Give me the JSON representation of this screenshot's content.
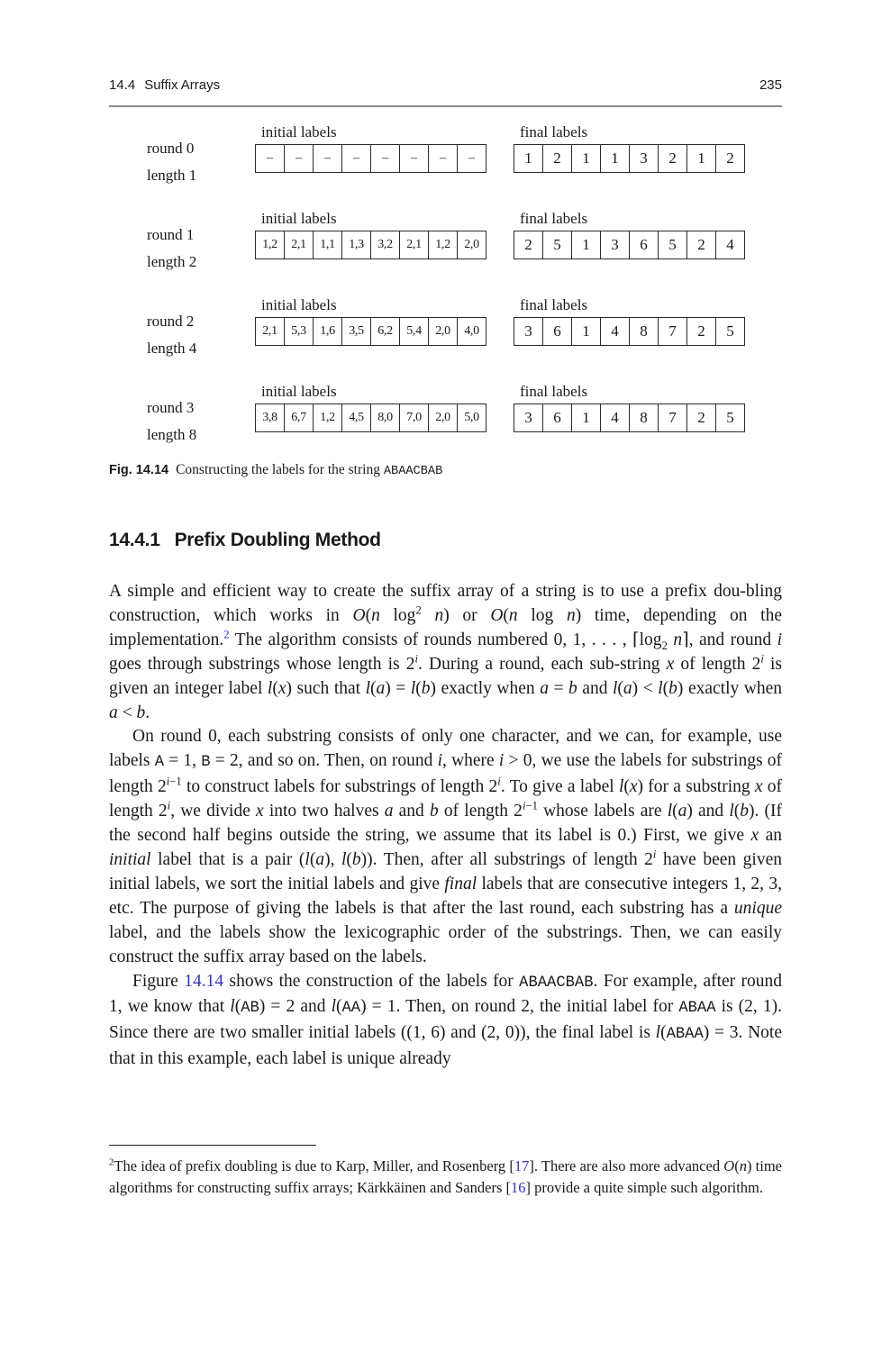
{
  "running_head": {
    "section_number": "14.4",
    "section_title": "Suffix Arrays",
    "page_number": "235"
  },
  "figure": {
    "initial_caption": "initial labels",
    "final_caption": "final labels",
    "rows": [
      {
        "round": "round 0",
        "length": "length 1",
        "initial": [
          "–",
          "–",
          "–",
          "–",
          "–",
          "–",
          "–",
          "–"
        ],
        "final": [
          "1",
          "2",
          "1",
          "1",
          "3",
          "2",
          "1",
          "2"
        ]
      },
      {
        "round": "round 1",
        "length": "length 2",
        "initial": [
          "1,2",
          "2,1",
          "1,1",
          "1,3",
          "3,2",
          "2,1",
          "1,2",
          "2,0"
        ],
        "final": [
          "2",
          "5",
          "1",
          "3",
          "6",
          "5",
          "2",
          "4"
        ]
      },
      {
        "round": "round 2",
        "length": "length 4",
        "initial": [
          "2,1",
          "5,3",
          "1,6",
          "3,5",
          "6,2",
          "5,4",
          "2,0",
          "4,0"
        ],
        "final": [
          "3",
          "6",
          "1",
          "4",
          "8",
          "7",
          "2",
          "5"
        ]
      },
      {
        "round": "round 3",
        "length": "length 8",
        "initial": [
          "3,8",
          "6,7",
          "1,2",
          "4,5",
          "8,0",
          "7,0",
          "2,0",
          "5,0"
        ],
        "final": [
          "3",
          "6",
          "1",
          "4",
          "8",
          "7",
          "2",
          "5"
        ]
      }
    ],
    "caption_number": "Fig. 14.14",
    "caption_text": "Constructing the labels for the string ",
    "caption_string": "ABAACBAB"
  },
  "section": {
    "number": "14.4.1",
    "title": "Prefix Doubling Method"
  },
  "paragraphs": {
    "p1": {
      "t1": "A simple and efficient way to create the suffix array of a string is to use a prefix dou-bling construction, which works in ",
      "m1": "O(n log² n)",
      "t2": " or ",
      "m2": "O(n log n)",
      "t3": " time, depending on the implementation.",
      "fnref": "2",
      "t4": " The algorithm consists of rounds numbered 0, 1, . . . , ⌈log₂ n⌉, and round ",
      "t5": " goes through substrings whose length is 2",
      "t6": ". During a round, each sub-string ",
      "t7": " of length 2",
      "t8": " is given an integer label ",
      "t9": " such that ",
      "t10": " exactly when ",
      "t11": " and ",
      "t12": " exactly when ",
      "t13": "."
    },
    "p2": "On round 0, each substring consists of only one character, and we can, for example, use labels A = 1, B = 2, and so on. Then, on round i, where i > 0, we use the labels for substrings of length 2^(i−1) to construct labels for substrings of length 2^i. To give a label l(x) for a substring x of length 2^i, we divide x into two halves a and b of length 2^(i−1) whose labels are l(a) and l(b). (If the second half begins outside the string, we assume that its label is 0.) First, we give x an initial label that is a pair (l(a), l(b)). Then, after all substrings of length 2^i have been given initial labels, we sort the initial labels and give final labels that are consecutive integers 1, 2, 3, etc. The purpose of giving the labels is that after the last round, each substring has a unique label, and the labels show the lexicographic order of the substrings. Then, we can easily construct the suffix array based on the labels.",
    "p3": {
      "t1": "Figure ",
      "link": "14.14",
      "t2": " shows the construction of the labels for ",
      "s1": "ABAACBAB",
      "t3": ". For example, after round 1, we know that ",
      "t4": " = 2 and ",
      "t5": " = 1. Then, on round 2, the initial label for ",
      "s2": "ABAA",
      "t6": " is (2, 1). Since there are two smaller initial labels ((1, 6) and (2, 0)), the final label is ",
      "t7": " = 3. Note that in this example, each label is unique already"
    }
  },
  "footnote": {
    "marker": "2",
    "t1": "The idea of prefix doubling is due to Karp, Miller, and Rosenberg [",
    "ref1": "17",
    "t2": "]. There are also more advanced ",
    "math": "O(n)",
    "t3": " time algorithms for constructing suffix arrays; Kärkkäinen and Sanders [",
    "ref2": "16",
    "t4": "] provide a quite simple such algorithm."
  },
  "colors": {
    "link": "#3333cc",
    "rule": "#8a8a8a"
  }
}
